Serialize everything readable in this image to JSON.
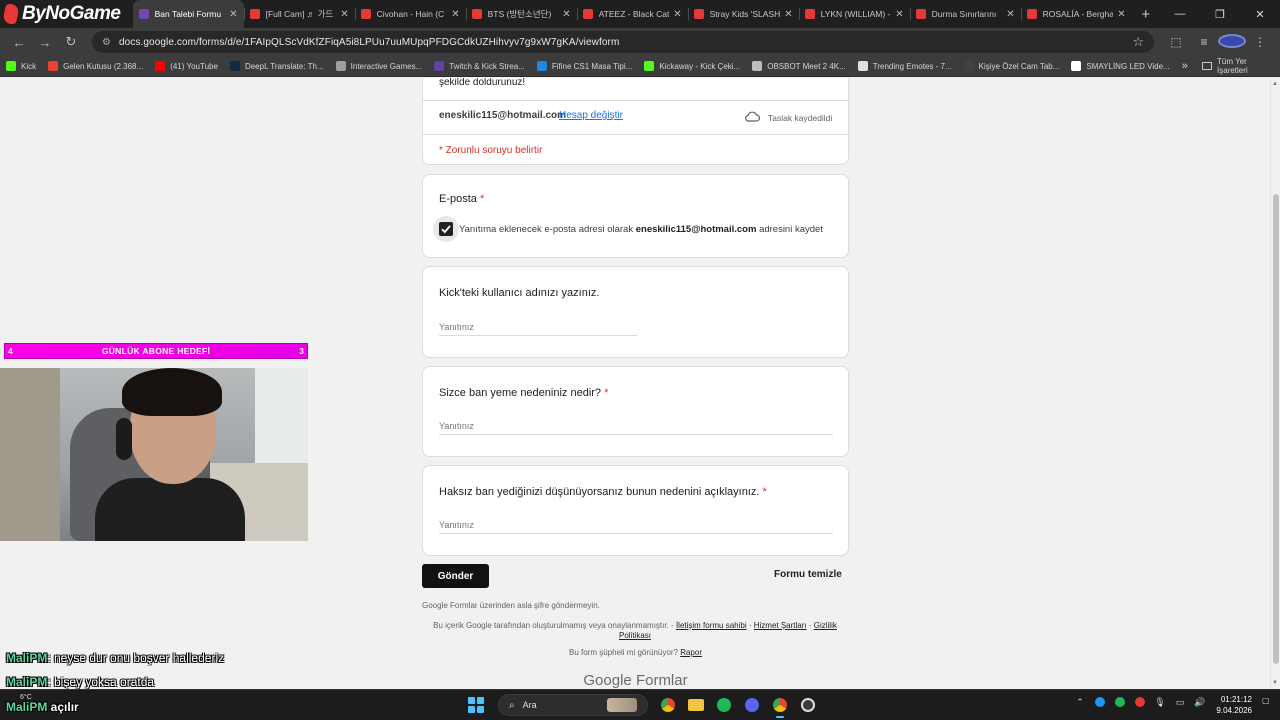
{
  "browser": {
    "brand": "ByNoGame",
    "tabs": [
      {
        "title": "Ban Talebi Formu",
        "color": "#7248b9",
        "active": true
      },
      {
        "title": "[Full Cam] ♬ 가드",
        "color": "#e53935",
        "active": false
      },
      {
        "title": "Civohan - Hain (C",
        "color": "#e53935",
        "active": false
      },
      {
        "title": "BTS (방탄소년단)",
        "color": "#e53935",
        "active": false
      },
      {
        "title": "ATEEZ - Black Cat",
        "color": "#e53935",
        "active": false
      },
      {
        "title": "Stray Kids 'SLASH",
        "color": "#e53935",
        "active": false
      },
      {
        "title": "LYKN (WILLIAM) -",
        "color": "#e53935",
        "active": false
      },
      {
        "title": "Durma Sınırlarını",
        "color": "#e53935",
        "active": false
      },
      {
        "title": "ROSALÍA - Bergha",
        "color": "#e53935",
        "active": false
      }
    ],
    "url": "docs.google.com/forms/d/e/1FAIpQLScVdKfZFiqA5i8LPUu7uuMUpqPFDGCdkUZHihvyv7g9xW7gKA/viewform",
    "bookmarks": [
      {
        "label": "Kick",
        "color": "#53fc18"
      },
      {
        "label": "Gelen Kutusu (2.368...",
        "color": "#ea4335"
      },
      {
        "label": "(41) YouTube",
        "color": "#ff0000"
      },
      {
        "label": "DeepL Translate: Th...",
        "color": "#0f2b46"
      },
      {
        "label": "Interactive Games...",
        "color": "#9e9e9e"
      },
      {
        "label": "Twitch & Kick Strea...",
        "color": "#6441a5"
      },
      {
        "label": "Fifine CS1 Masa Tipi...",
        "color": "#1e88e5"
      },
      {
        "label": "Kickaway - Kick Çeki...",
        "color": "#53fc18"
      },
      {
        "label": "OBSBOT Meet 2 4K...",
        "color": "#bdbdbd"
      },
      {
        "label": "Trending Emotes - 7...",
        "color": "#e0e0e0"
      },
      {
        "label": "Kişiye Özel Cam Tab...",
        "color": "#424242"
      },
      {
        "label": "SMAYLİNG LED Vide...",
        "color": "#ffffff"
      }
    ],
    "bookmarks_more": "»",
    "all_bookmarks": "Tüm Yer İşaretleri"
  },
  "form": {
    "desc_tail": "şekilde doldurunuz!",
    "account_email": "eneskilic115@hotmail.com",
    "switch_account": "Hesap değiştir",
    "draft_saved": "Taslak kaydedildi",
    "required_note": "* Zorunlu soruyu belirtir",
    "email_question": {
      "title": "E-posta",
      "required_mark": "*",
      "checkbox_prefix": "Yanıtıma eklenecek e-posta adresi olarak",
      "checkbox_email": "eneskilic115@hotmail.com",
      "checkbox_suffix": "adresini kaydet",
      "checked": true
    },
    "questions": [
      {
        "title": "Kick'teki kullanıcı adınızı yazınız.",
        "required_mark": "",
        "placeholder": "Yanıtınız"
      },
      {
        "title": "Sizce ban yeme nedeniniz nedir?",
        "required_mark": "*",
        "placeholder": "Yanıtınız"
      },
      {
        "title": "Haksız ban yediğinizi düşünüyorsanız bunun nedenini açıklayınız.",
        "required_mark": "*",
        "placeholder": "Yanıtınız"
      }
    ],
    "submit_label": "Gönder",
    "clear_label": "Formu temizle",
    "no_password": "Google Formlar üzerinden asla şifre göndermeyin.",
    "disclaimer_text": "Bu içerik Google tarafından oluşturulmamış veya onaylanmamıştır. -",
    "disclaimer_link_1": "İletişim formu sahibi",
    "disclaimer_link_2": "Hizmet Şartları",
    "disclaimer_link_3": "Gizlilik Politikası",
    "report_text": "Bu form şüpheli mi görünüyor?",
    "report_link": "Rapor",
    "logo_google": "Google",
    "logo_forms": "Formlar"
  },
  "overlay": {
    "goal_left": "4",
    "goal_title": "GÜNLÜK ABONE HEDEFİ",
    "goal_right": "3",
    "chat": [
      {
        "user": "MaliPM",
        "msg": ": neyse dur onu boşver hallederiz"
      },
      {
        "user": "MaliPM",
        "msg": ": bişey yoksa oratda"
      },
      {
        "user": "MaliPM",
        "msg": " açılır"
      }
    ]
  },
  "taskbar": {
    "weather": "6°C",
    "search_label": "Ara",
    "time": "01:21:12",
    "date": "9.04.2026"
  }
}
